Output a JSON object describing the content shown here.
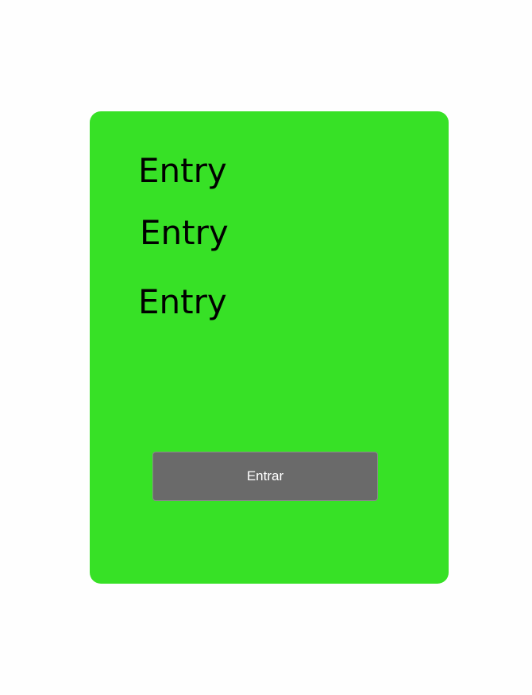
{
  "form": {
    "entries": [
      {
        "text": "Entry"
      },
      {
        "text": "Entry"
      },
      {
        "text": "Entry"
      }
    ],
    "submit_label": "Entrar"
  },
  "colors": {
    "background": "#fefefe",
    "card": "#37e126",
    "button": "#6a6a6a",
    "button_text": "#ffffff",
    "entry_text": "#000000"
  }
}
